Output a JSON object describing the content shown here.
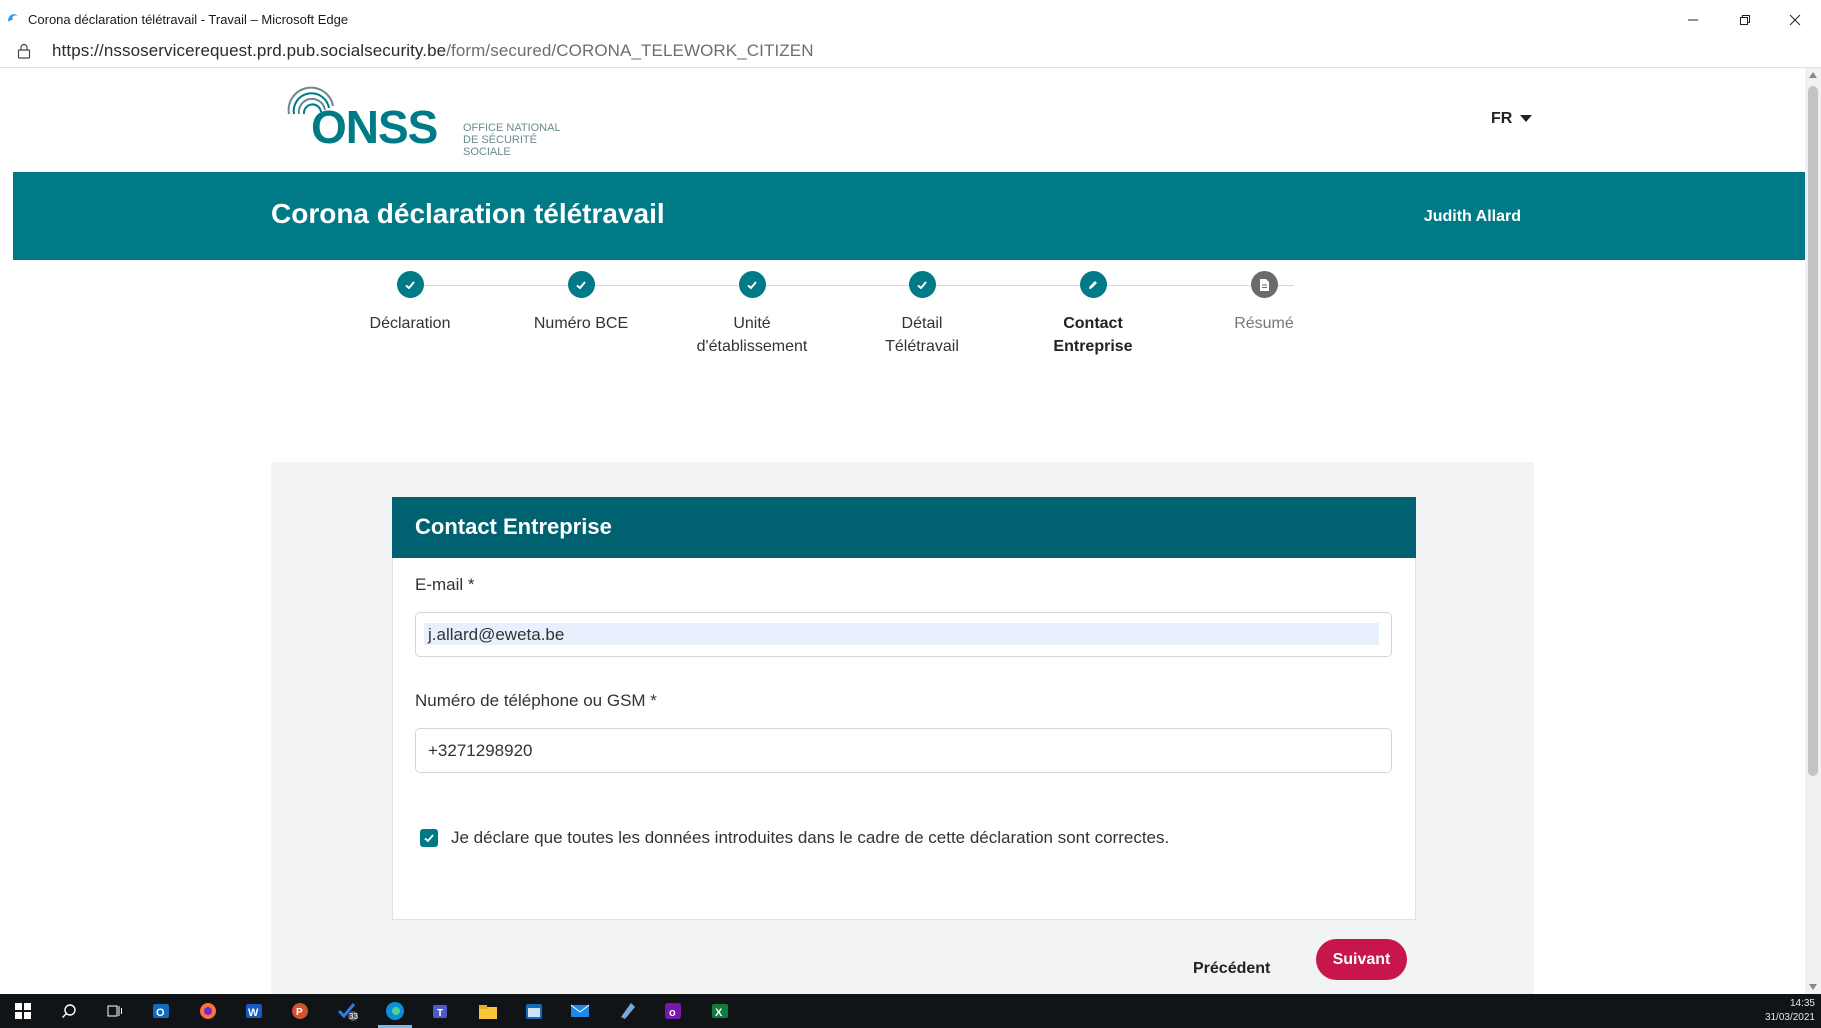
{
  "window": {
    "title": "Corona déclaration télétravail - Travail – Microsoft Edge",
    "controls": [
      "minimize",
      "restore",
      "close"
    ]
  },
  "address_bar": {
    "url_host": "https://nssoservicerequest.prd.pub.socialsecurity.be",
    "url_path": "/form/secured/CORONA_TELEWORK_CITIZEN"
  },
  "header": {
    "logo_text": "ONSS",
    "logo_subtitle_lines": [
      "OFFICE NATIONAL",
      "DE SÉCURITÉ",
      "SOCIALE"
    ],
    "language": "FR"
  },
  "banner": {
    "title": "Corona déclaration télétravail",
    "user_name": "Judith Allard",
    "color": "#007a87"
  },
  "stepper": {
    "steps": [
      {
        "label": "Déclaration",
        "state": "done"
      },
      {
        "label": "Numéro BCE",
        "state": "done"
      },
      {
        "label": "Unité d'établissement",
        "line1": "Unité",
        "line2": "d'établissement",
        "state": "done"
      },
      {
        "label": "Détail Télétravail",
        "line1": "Détail",
        "line2": "Télétravail",
        "state": "done"
      },
      {
        "label": "Contact Entreprise",
        "line1": "Contact",
        "line2": "Entreprise",
        "state": "current"
      },
      {
        "label": "Résumé",
        "state": "todo"
      }
    ]
  },
  "form": {
    "card_title": "Contact Entreprise",
    "email_label": "E-mail *",
    "email_value": "j.allard@eweta.be",
    "phone_label": "Numéro de téléphone ou GSM *",
    "phone_value": "+3271298920",
    "declaration_checked": true,
    "declaration_text": "Je déclare que toutes les données introduites dans le cadre de cette déclaration sont correctes.",
    "prev_label": "Précédent",
    "next_label": "Suivant",
    "accent": "#c8154b"
  },
  "taskbar": {
    "icons": [
      "windows-start-icon",
      "search-icon",
      "task-view-icon",
      "outlook-icon",
      "firefox-icon",
      "word-icon",
      "powerpoint-icon",
      "todo-icon",
      "edge-icon",
      "teams-icon",
      "file-explorer-icon",
      "calendar-icon",
      "mail-icon",
      "notes-icon",
      "onenote-icon",
      "excel-icon"
    ],
    "todo_badge": "33",
    "time": "14:35",
    "date": "31/03/2021"
  }
}
